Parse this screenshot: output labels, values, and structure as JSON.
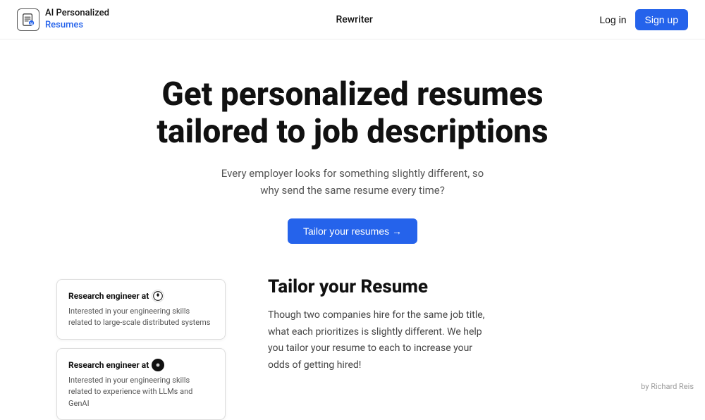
{
  "header": {
    "logo_line1": "AI Personalized",
    "logo_line2": "Resumes",
    "nav_link": "Rewriter",
    "login_label": "Log in",
    "signup_label": "Sign up"
  },
  "hero": {
    "heading": "Get personalized resumes tailored to job descriptions",
    "subtext": "Every employer looks for something slightly different, so why send the same resume every time?",
    "cta_label": "Tailor your resumes →"
  },
  "cards": [
    {
      "title": "Research engineer at",
      "company_icon": "🟢",
      "company_icon_type": "openai",
      "body": "Interested in your engineering skills related to large-scale distributed systems"
    },
    {
      "title": "Research engineer at",
      "company_icon": "⚫",
      "company_icon_type": "anthropic",
      "body": "Interested in your engineering skills related to experience with LLMs and GenAI"
    }
  ],
  "feature": {
    "heading": "Tailor your Resume",
    "body": "Though two companies hire for the same job title, what each prioritizes is slightly different. We help you tailor your resume to each to increase your odds of getting hired!"
  },
  "footer": {
    "credit": "by Richard Reis"
  }
}
